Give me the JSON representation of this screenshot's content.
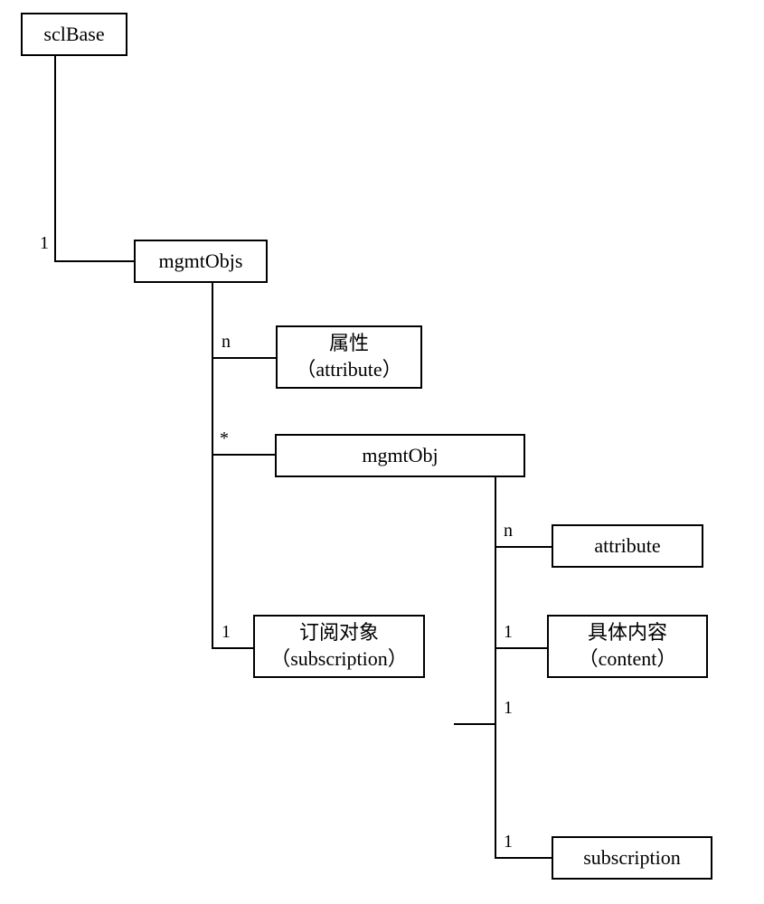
{
  "nodes": {
    "sclBase": "sclBase",
    "mgmtObjs": "mgmtObjs",
    "attribute_cn_line1": "属性",
    "attribute_cn_line2": "（attribute）",
    "mgmtObj": "mgmtObj",
    "attribute_en": "attribute",
    "subscription_cn_line1": "订阅对象",
    "subscription_cn_line2": "（subscription）",
    "content_cn_line1": "具体内容",
    "content_cn_line2": "（content）",
    "subscription_en": "subscription"
  },
  "cardinalities": {
    "c1": "1",
    "c2": "n",
    "c3": "*",
    "c4": "1",
    "c5": "n",
    "c6": "1",
    "c7": "1",
    "c8": "1"
  }
}
